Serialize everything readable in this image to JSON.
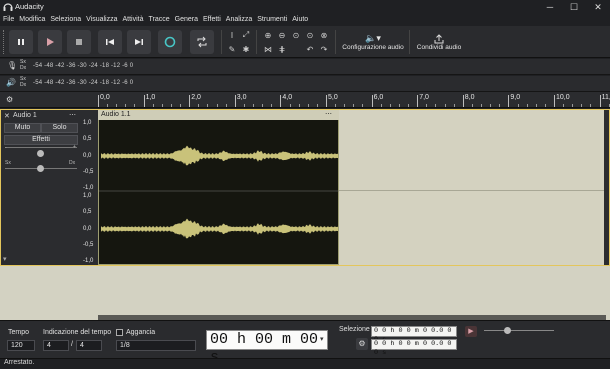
{
  "window": {
    "title": "Audacity"
  },
  "menu": [
    "File",
    "Modifica",
    "Seleziona",
    "Visualizza",
    "Attività",
    "Tracce",
    "Genera",
    "Effetti",
    "Analizza",
    "Strumenti",
    "Aiuto"
  ],
  "toolbar": {
    "audio_setup_label": "Configurazione audio",
    "share_audio_label": "Condividi audio"
  },
  "meters": {
    "record_scale": "-54 -48 -42 -36 -30 -24 -18 -12 -6 0",
    "play_scale": "-54 -48 -42 -36 -30 -24 -18 -12 -6 0",
    "lr_top": "Sx",
    "lr_bottom": "Dx"
  },
  "ruler": {
    "ticks": [
      "0,0",
      "1,0",
      "2,0",
      "3,0",
      "4,0",
      "5,0",
      "6,0",
      "7,0",
      "8,0",
      "9,0",
      "10,0",
      "11,0"
    ]
  },
  "track": {
    "name": "Audio 1",
    "mute_label": "Muto",
    "solo_label": "Solo",
    "effects_label": "Effetti",
    "pan_left": "Sx",
    "pan_right": "Dx",
    "clip_name": "Audio 1.1",
    "vruler_channel1": [
      "1,0",
      "0,5",
      "0,0",
      "-0,5",
      "-1,0"
    ],
    "vruler_channel2": [
      "1,0",
      "0,5",
      "0,0",
      "-0,5",
      "-1,0"
    ]
  },
  "bottom": {
    "tempo_label": "Tempo",
    "tempo_value": "120",
    "time_sig_label": "Indicazione del tempo",
    "time_sig_num": "4",
    "time_sig_sep": "/",
    "time_sig_den": "4",
    "snap_label": "Aggancia",
    "snap_value": "1/8",
    "time_display": "00 h 00 m 00 s",
    "selection_label": "Selezione",
    "selection_start": "0 0 h 0 0 m 0 0.0 0 0 s",
    "selection_end": "0 0 h 0 0 m 0 0.0 0 0 s"
  },
  "status": {
    "text": "Arrestato."
  },
  "colors": {
    "accent": "#e3c65c",
    "waveform": "#d6d07a",
    "play_green": "#9c9c9c"
  }
}
